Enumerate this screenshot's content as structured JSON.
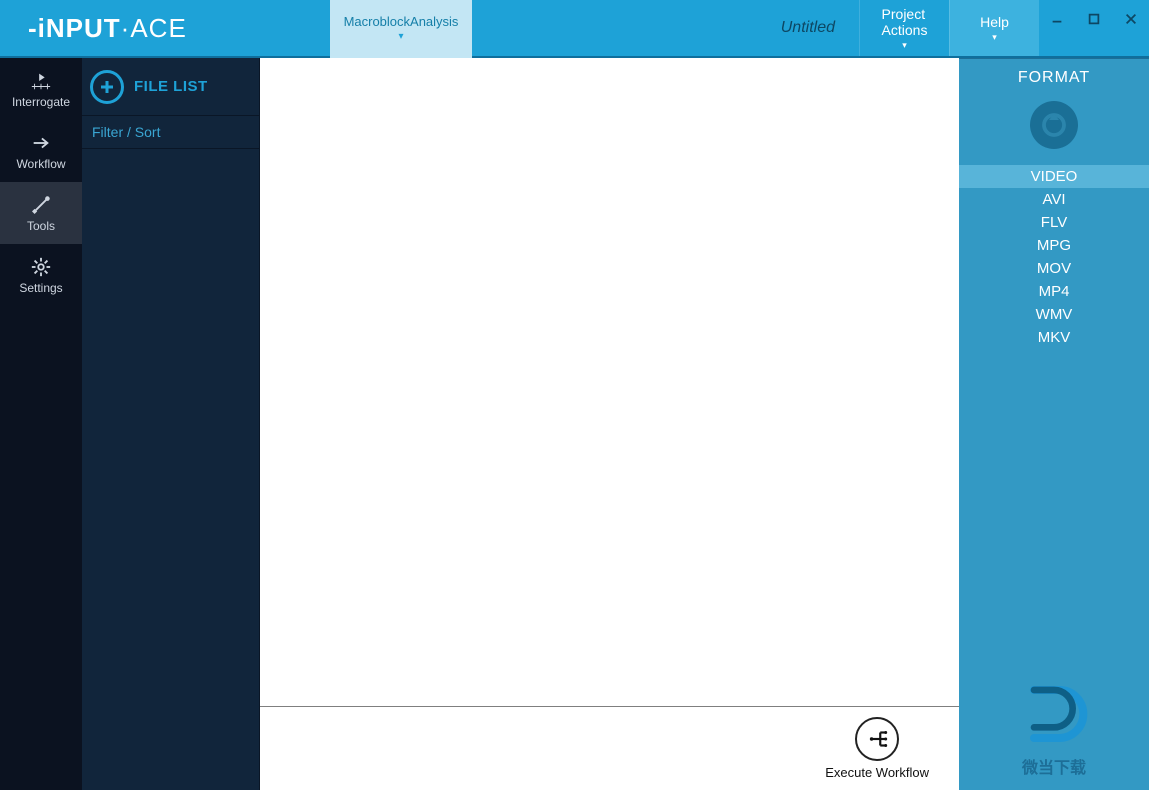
{
  "app": {
    "logo_text": "-iNPUT·ACE"
  },
  "titlebar": {
    "tab_label": "MacroblockAnalysis",
    "document_title": "Untitled",
    "project_actions_label": "Project\nActions",
    "help_label": "Help"
  },
  "rail": {
    "items": [
      {
        "id": "interrogate",
        "label": "Interrogate"
      },
      {
        "id": "workflow",
        "label": "Workflow"
      },
      {
        "id": "tools",
        "label": "Tools"
      },
      {
        "id": "settings",
        "label": "Settings"
      }
    ],
    "active_index": 2
  },
  "filepanel": {
    "header_label": "FILE LIST",
    "filter_label": "Filter / Sort"
  },
  "footer": {
    "execute_label": "Execute Workflow"
  },
  "format": {
    "header": "FORMAT",
    "items": [
      "VIDEO",
      "AVI",
      "FLV",
      "MPG",
      "MOV",
      "MP4",
      "WMV",
      "MKV"
    ],
    "selected_index": 0,
    "watermark_text": "微当下载"
  }
}
